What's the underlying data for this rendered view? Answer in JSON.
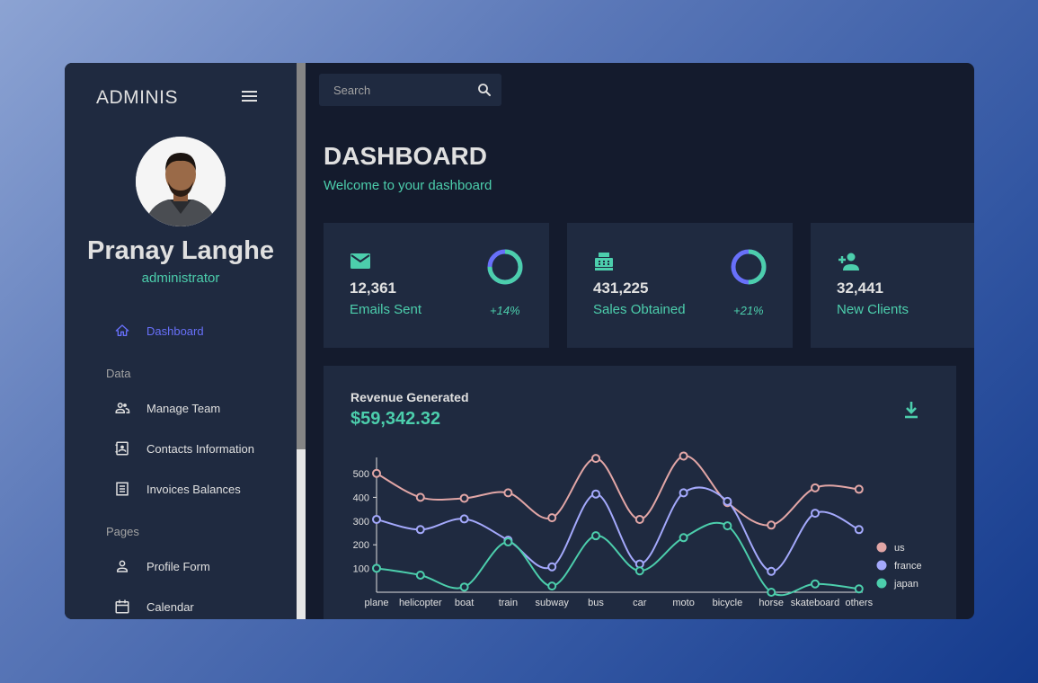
{
  "brand": "ADMINIS",
  "user": {
    "name": "Pranay Langhe",
    "role": "administrator"
  },
  "nav": {
    "dashboard": "Dashboard",
    "section_data": "Data",
    "manage_team": "Manage Team",
    "contacts": "Contacts Information",
    "invoices": "Invoices Balances",
    "section_pages": "Pages",
    "profile_form": "Profile Form",
    "calendar": "Calendar"
  },
  "search": {
    "placeholder": "Search"
  },
  "header": {
    "title": "DASHBOARD",
    "subtitle": "Welcome to your dashboard"
  },
  "stats": [
    {
      "value": "12,361",
      "label": "Emails Sent",
      "percent": "+14%",
      "progress": 0.75,
      "icon": "email-icon"
    },
    {
      "value": "431,225",
      "label": "Sales Obtained",
      "percent": "+21%",
      "progress": 0.5,
      "icon": "point-of-sale-icon"
    },
    {
      "value": "32,441",
      "label": "New Clients",
      "icon": "person-add-icon"
    }
  ],
  "revenue": {
    "title": "Revenue Generated",
    "value": "$59,342.32"
  },
  "colors": {
    "accent": "#4cceac",
    "primary_light": "#6870fa",
    "us": "#e2a6a6",
    "france": "#a4a9fc",
    "japan": "#4cceac"
  },
  "chart_data": {
    "type": "line",
    "categories": [
      "plane",
      "helicopter",
      "boat",
      "train",
      "subway",
      "bus",
      "car",
      "moto",
      "bicycle",
      "horse",
      "skateboard",
      "others"
    ],
    "series": [
      {
        "name": "us",
        "values": [
          501,
          400,
          396,
          419,
          314,
          564,
          307,
          574,
          378,
          283,
          440,
          434
        ]
      },
      {
        "name": "france",
        "values": [
          307,
          264,
          309,
          219,
          107,
          414,
          119,
          419,
          383,
          88,
          333,
          264
        ]
      },
      {
        "name": "japan",
        "values": [
          101,
          72,
          22,
          212,
          26,
          238,
          90,
          230,
          280,
          0,
          35,
          14
        ]
      }
    ],
    "yticks": [
      100,
      200,
      300,
      400,
      500
    ],
    "ylim": [
      0,
      600
    ],
    "legend": "right",
    "grid": false
  }
}
